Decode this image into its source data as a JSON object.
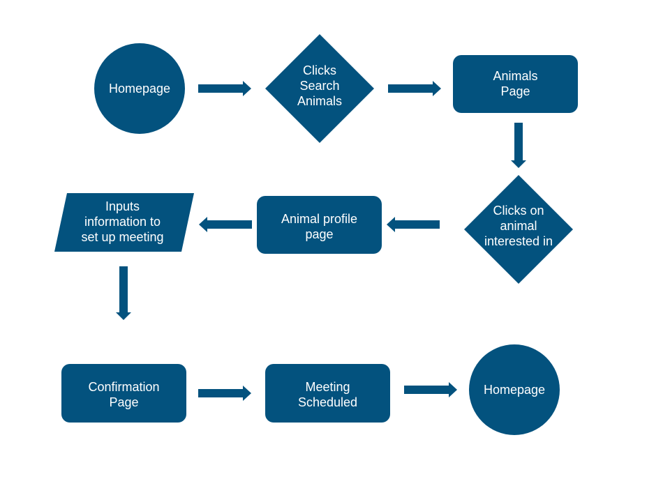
{
  "diagram": {
    "type": "flowchart",
    "colors": {
      "shape_fill": "#03527e",
      "arrow": "#03527e",
      "text": "#ffffff",
      "background": "#ffffff"
    },
    "nodes": [
      {
        "id": "homepage-start",
        "shape": "circle",
        "label": "Homepage"
      },
      {
        "id": "clicks-search-animals",
        "shape": "diamond",
        "label": "Clicks\nSearch\nAnimals"
      },
      {
        "id": "animals-page",
        "shape": "rounded-rect",
        "label": "Animals\nPage"
      },
      {
        "id": "clicks-on-animal",
        "shape": "diamond",
        "label": "Clicks on\nanimal\ninterested in"
      },
      {
        "id": "animal-profile-page",
        "shape": "rounded-rect",
        "label": "Animal profile\npage"
      },
      {
        "id": "inputs-information",
        "shape": "parallelogram",
        "label": "Inputs\ninformation to\nset up meeting"
      },
      {
        "id": "confirmation-page",
        "shape": "rounded-rect",
        "label": "Confirmation\nPage"
      },
      {
        "id": "meeting-scheduled",
        "shape": "rounded-rect",
        "label": "Meeting\nScheduled"
      },
      {
        "id": "homepage-end",
        "shape": "circle",
        "label": "Homepage"
      }
    ],
    "edges": [
      {
        "from": "homepage-start",
        "to": "clicks-search-animals"
      },
      {
        "from": "clicks-search-animals",
        "to": "animals-page"
      },
      {
        "from": "animals-page",
        "to": "clicks-on-animal"
      },
      {
        "from": "clicks-on-animal",
        "to": "animal-profile-page"
      },
      {
        "from": "animal-profile-page",
        "to": "inputs-information"
      },
      {
        "from": "inputs-information",
        "to": "confirmation-page"
      },
      {
        "from": "confirmation-page",
        "to": "meeting-scheduled"
      },
      {
        "from": "meeting-scheduled",
        "to": "homepage-end"
      }
    ]
  }
}
